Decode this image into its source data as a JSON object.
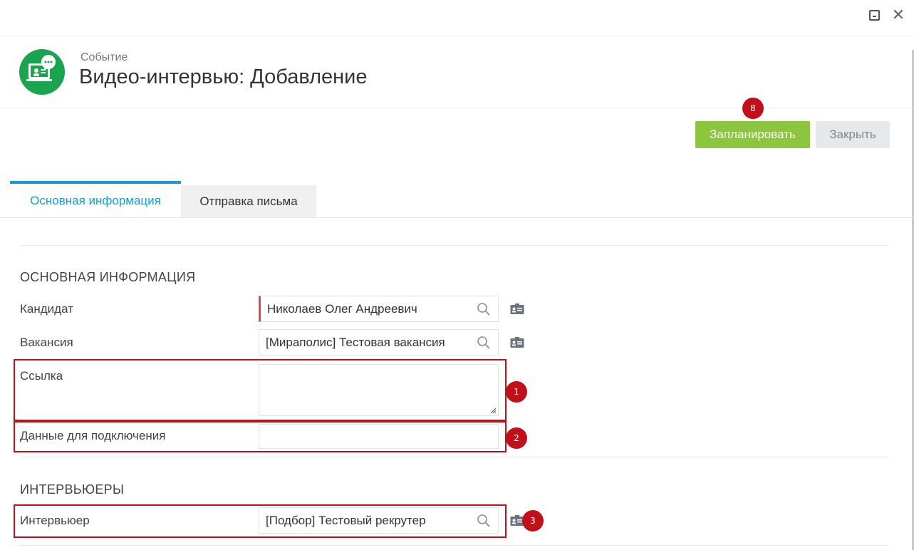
{
  "window": {
    "minimize_icon": "minimize-icon",
    "close_icon": "close-icon",
    "close_glyph": "✕"
  },
  "header": {
    "subtitle": "Событие",
    "title": "Видео-интервью: Добавление",
    "icon": "video-chat-icon",
    "icon_color": "#1aa450"
  },
  "toolbar": {
    "schedule_label": "Запланировать",
    "close_label": "Закрыть",
    "schedule_badge": "8",
    "primary_color": "#8cc63f"
  },
  "tabs": [
    {
      "label": "Основная информация",
      "active": true
    },
    {
      "label": "Отправка письма",
      "active": false
    }
  ],
  "sections": {
    "main": {
      "title": "ОСНОВНАЯ ИНФОРМАЦИЯ",
      "candidate": {
        "label": "Кандидат",
        "value": "Николаев Олег Андреевич"
      },
      "vacancy": {
        "label": "Вакансия",
        "value": "[Мираполис] Тестовая вакансия"
      },
      "link": {
        "label": "Ссылка",
        "value": "",
        "badge": "1"
      },
      "connection": {
        "label": "Данные для подключения",
        "value": "",
        "badge": "2"
      }
    },
    "interviewers": {
      "title": "ИНТЕРВЬЮЕРЫ",
      "interviewer": {
        "label": "Интервьюер",
        "value": "[Подбор] Тестовый рекрутер",
        "badge": "3"
      }
    }
  },
  "colors": {
    "accent": "#1a9bd7",
    "highlight": "#c1101a",
    "required": "#e04848"
  }
}
